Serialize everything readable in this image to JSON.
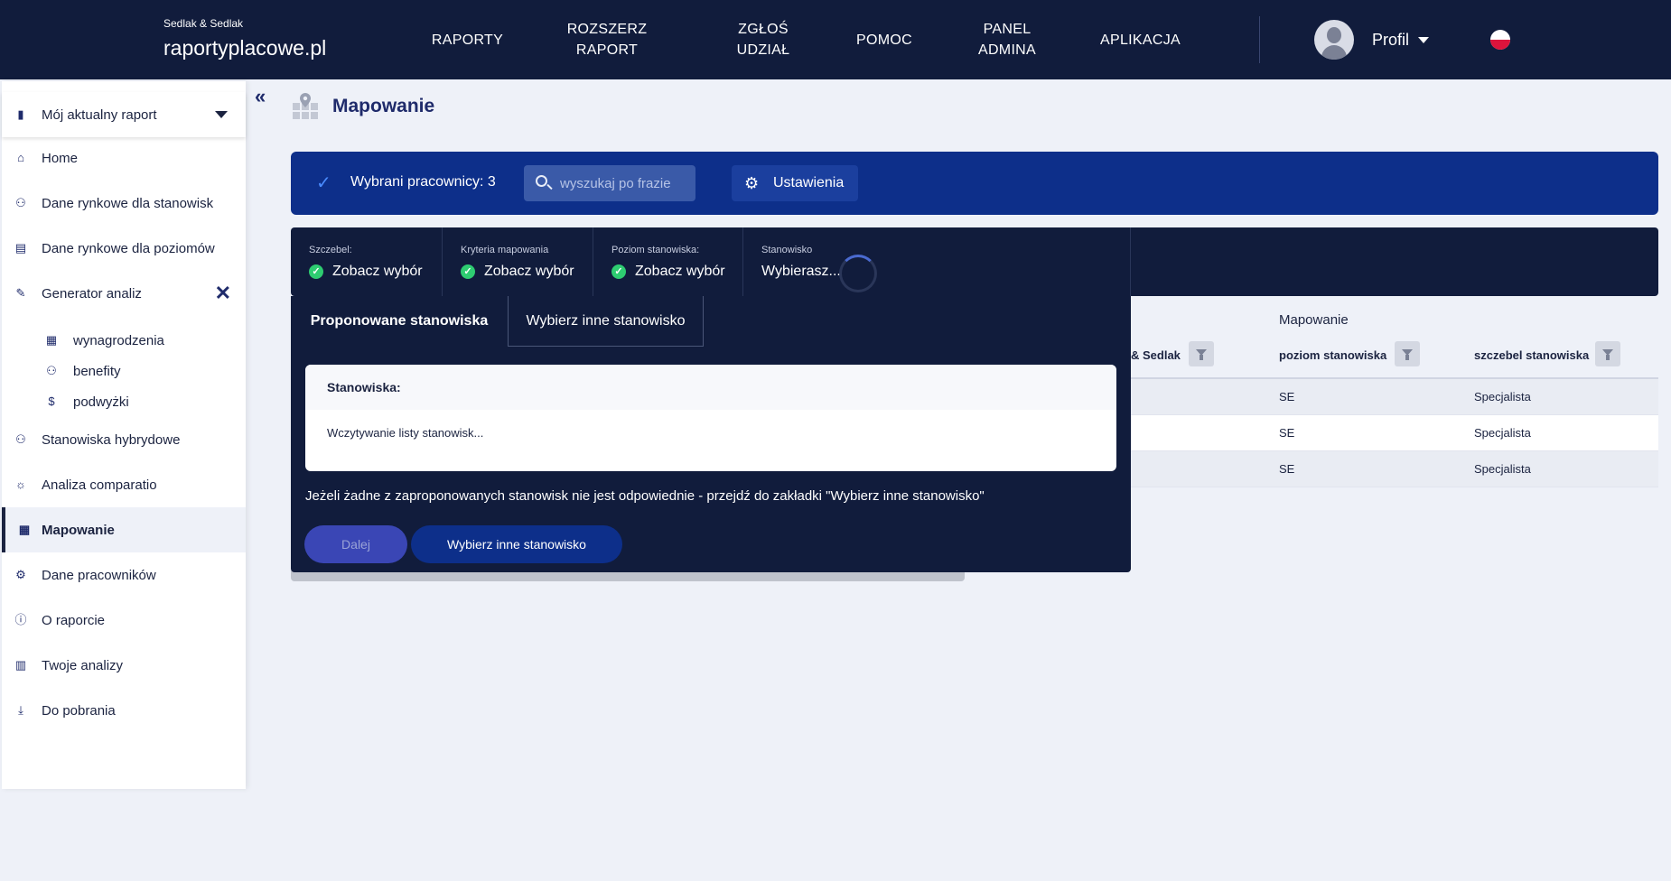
{
  "brand": {
    "small": "Sedlak & Sedlak",
    "main": "raportyplacowe.pl"
  },
  "nav": [
    {
      "label": "RAPORTY"
    },
    {
      "label": "ROZSZERZ RAPORT"
    },
    {
      "label": "ZGŁOŚ UDZIAŁ"
    },
    {
      "label": "POMOC"
    },
    {
      "label": "PANEL ADMINA"
    },
    {
      "label": "APLIKACJA"
    }
  ],
  "profile": {
    "label": "Profil"
  },
  "sidebar": {
    "report_select": "Mój aktualny raport",
    "items": [
      {
        "label": "Home",
        "icon": "home-icon"
      },
      {
        "label": "Dane rynkowe dla stanowisk",
        "icon": "users-icon"
      },
      {
        "label": "Dane rynkowe dla poziomów",
        "icon": "document-icon"
      },
      {
        "label": "Generator analiz",
        "icon": "wand-icon"
      },
      {
        "label": "Stanowiska hybrydowe",
        "icon": "users-icon"
      },
      {
        "label": "Analiza comparatio",
        "icon": "sun-icon"
      },
      {
        "label": "Mapowanie",
        "icon": "map-icon"
      },
      {
        "label": "Dane pracowników",
        "icon": "gear-icon"
      },
      {
        "label": "O raporcie",
        "icon": "info-icon"
      },
      {
        "label": "Twoje analizy",
        "icon": "clipboard-icon"
      },
      {
        "label": "Do pobrania",
        "icon": "download-icon"
      }
    ],
    "sub_items": [
      {
        "label": "wynagrodzenia"
      },
      {
        "label": "benefity"
      },
      {
        "label": "podwyżki"
      }
    ]
  },
  "page": {
    "title": "Mapowanie"
  },
  "toolbar": {
    "selected_label": "Wybrani pracownicy: 3",
    "search_placeholder": "wyszukaj po frazie",
    "settings_label": "Ustawienia"
  },
  "filters": [
    {
      "label": "Szczebel:",
      "value": "Zobacz wybór"
    },
    {
      "label": "Kryteria mapowania",
      "value": "Zobacz wybór"
    },
    {
      "label": "Poziom stanowiska:",
      "value": "Zobacz wybór"
    },
    {
      "label": "Stanowisko",
      "value": "Wybierasz..."
    }
  ],
  "table": {
    "group_header": "Mapowanie",
    "headers": [
      "& Sedlak",
      "poziom stanowiska",
      "szczebel stanowiska"
    ],
    "rows": [
      [
        "SE",
        "Specjalista"
      ],
      [
        "SE",
        "Specjalista"
      ],
      [
        "SE",
        "Specjalista"
      ]
    ]
  },
  "panel": {
    "tabs": [
      "Proponowane stanowiska",
      "Wybierz inne stanowisko"
    ],
    "card_title": "Stanowiska:",
    "card_body": "Wczytywanie listy stanowisk...",
    "info": "Jeżeli żadne z zaproponowanych stanowisk nie jest odpowiednie - przejdź do zakładki \"Wybierz inne stanowisko\"",
    "next_button": "Dalej",
    "other_button": "Wybierz inne stanowisko"
  }
}
